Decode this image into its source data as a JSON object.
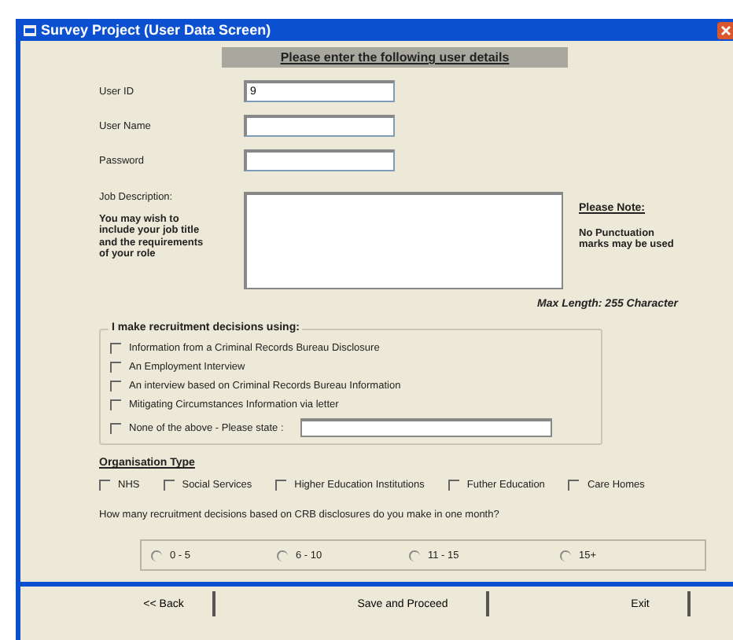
{
  "window": {
    "title": "Survey Project (User Data Screen)"
  },
  "heading": "Please enter the following user details",
  "fields": [
    {
      "label": "User ID",
      "value": "9"
    },
    {
      "label": "User Name"
    },
    {
      "label": "Password"
    }
  ],
  "job_description": {
    "label": "Job Description:",
    "hint": "You may wish to include your job title and the requirements of your role",
    "note_title": "Please Note:",
    "note": "No Punctuation marks may be used",
    "max_length": "Max Length: 255 Character"
  },
  "recruitment": {
    "title": "I make recruitment decisions using:",
    "options": [
      {
        "label": "Information from a Criminal Records Bureau Disclosure",
        "checked": false
      },
      {
        "label": "An Employment Interview",
        "checked": false
      },
      {
        "label": "An interview based on Criminal Records Bureau Information",
        "checked": false
      },
      {
        "label": "Mitigating Circumstances Information via letter",
        "checked": false
      },
      {
        "label": "None of the above - Please state :",
        "checked": false,
        "kind": "other"
      }
    ]
  },
  "organisation": {
    "title": "Organisation Type",
    "options": [
      {
        "label": "NHS",
        "checked": false
      },
      {
        "label": "Social Services",
        "checked": false
      },
      {
        "label": "Higher Education Institutions",
        "checked": false
      },
      {
        "label": "Futher Education",
        "checked": false
      },
      {
        "label": "Care Homes",
        "checked": false
      }
    ]
  },
  "question": "How many recruitment decisions based on CRB disclosures do you make in one month?",
  "ranges": [
    {
      "label": "0 - 5",
      "selected": false
    },
    {
      "label": "6 - 10",
      "selected": false
    },
    {
      "label": "11 - 15",
      "selected": false
    },
    {
      "label": "15+",
      "selected": false
    }
  ],
  "buttons": [
    "<< Back",
    "Save and Proceed",
    "Exit"
  ]
}
